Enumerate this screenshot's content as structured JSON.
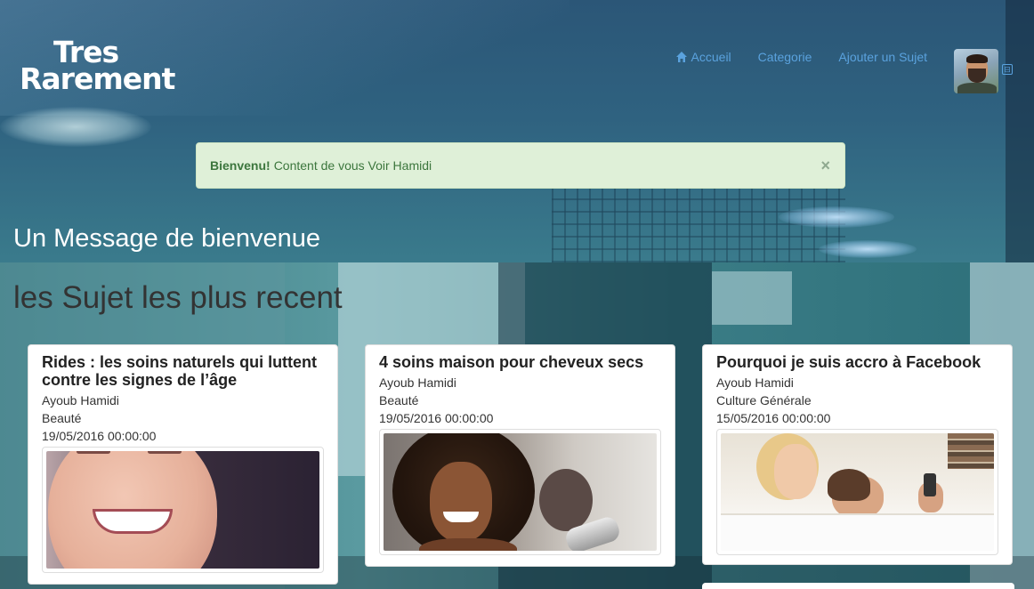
{
  "brand": {
    "line1": "Tres",
    "line2": "Rarement"
  },
  "nav": {
    "items": [
      {
        "label": "Accueil",
        "icon": "home-icon"
      },
      {
        "label": "Categorie"
      },
      {
        "label": "Ajouter un Sujet"
      }
    ]
  },
  "user": {
    "avatar": "avatar",
    "badge": "⊟"
  },
  "alert": {
    "strong": "Bienvenu!",
    "message": "Content de vous Voir Hamidi",
    "close": "×"
  },
  "hero": {
    "title": "Un Message de bienvenue"
  },
  "section": {
    "title": "les Sujet les plus recent"
  },
  "cards": [
    {
      "title": "Rides : les soins naturels qui luttent contre les signes de l’âge",
      "author": "Ayoub Hamidi",
      "category": "Beauté",
      "date": "19/05/2016 00:00:00"
    },
    {
      "title": "4 soins maison pour cheveux secs",
      "author": "Ayoub Hamidi",
      "category": "Beauté",
      "date": "19/05/2016 00:00:00"
    },
    {
      "title": "Pourquoi je suis accro à Facebook",
      "author": "Ayoub Hamidi",
      "category": "Culture Générale",
      "date": "15/05/2016 00:00:00"
    }
  ],
  "colors": {
    "nav_link": "#5aa2de",
    "alert_bg": "#dff0d8",
    "alert_text": "#3c763d",
    "card_bg": "#ffffff",
    "section_title": "#333333"
  }
}
